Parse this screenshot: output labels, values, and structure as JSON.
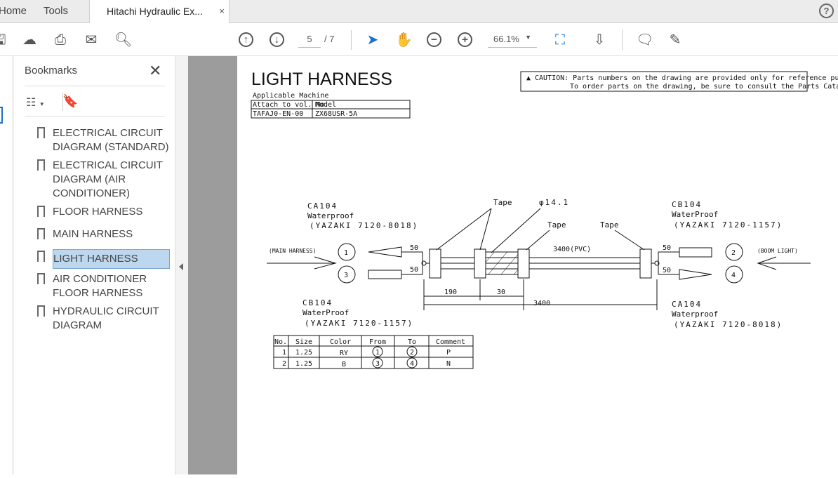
{
  "tabs": {
    "home": "Home",
    "tools": "Tools",
    "document": "Hitachi Hydraulic Ex...",
    "close": "×"
  },
  "toolbar": {
    "page_current": "5",
    "page_total": "/ 7",
    "zoom": "66.1%"
  },
  "bookmarks": {
    "title": "Bookmarks",
    "close": "✕",
    "items": [
      {
        "label": "ELECTRICAL CIRCUIT DIAGRAM (STANDARD)"
      },
      {
        "label": "ELECTRICAL CIRCUIT DIAGRAM (AIR CONDITIONER)"
      },
      {
        "label": "FLOOR HARNESS"
      },
      {
        "label": "MAIN HARNESS"
      },
      {
        "label": "LIGHT HARNESS"
      },
      {
        "label": "AIR CONDITIONER FLOOR HARNESS"
      },
      {
        "label": "HYDRAULIC CIRCUIT DIAGRAM"
      }
    ]
  },
  "doc": {
    "title": "LIGHT HARNESS",
    "applicable": "Applicable Machine",
    "machine_table": {
      "headers": [
        "Attach to vol. No.",
        "Model"
      ],
      "row": [
        "TAFAJ0-EN-00",
        "ZX68USR-5A"
      ]
    },
    "caution": [
      "CAUTION: Parts numbers on the drawing are provided only for reference purpose.",
      "To order parts on the drawing, be sure to consult the Parts Catalog."
    ],
    "diagram": {
      "main_harness": "(MAIN HARNESS)",
      "boom_light": "(BOOM LIGHT)",
      "tl": [
        "CA104",
        "Waterproof",
        "(YAZAKI 7120-8018)"
      ],
      "tr": [
        "CB104",
        "WaterProof",
        "(YAZAKI 7120-1157)"
      ],
      "bl": [
        "CB104",
        "WaterProof",
        "(YAZAKI 7120-1157)"
      ],
      "br": [
        "CA104",
        "Waterproof",
        "(YAZAKI 7120-8018)"
      ],
      "tape": "Tape",
      "diameter": "φ14.1",
      "pvc": "3400(PVC)",
      "fifty": "50",
      "d190": "190",
      "d30": "30",
      "d3400": "3400",
      "n1": "1",
      "n2": "2",
      "n3": "3",
      "n4": "4"
    },
    "wire_table": {
      "headers": [
        "No.",
        "Size",
        "Color",
        "From",
        "To",
        "Comment"
      ],
      "rows": [
        [
          "1",
          "1.25",
          "RY",
          "1",
          "2",
          "P"
        ],
        [
          "2",
          "1.25",
          "B",
          "3",
          "4",
          "N"
        ]
      ]
    }
  }
}
